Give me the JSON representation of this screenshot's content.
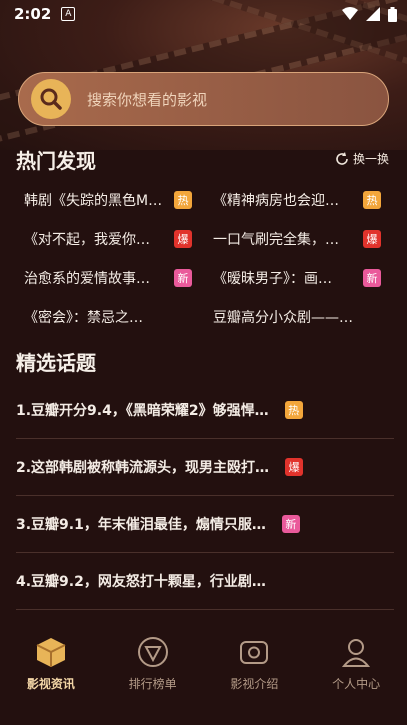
{
  "status_bar": {
    "time": "2:02",
    "notif_icon": "A"
  },
  "search": {
    "placeholder": "搜索你想看的影视"
  },
  "hot": {
    "title": "热门发现",
    "refresh_label": "换一换",
    "items": [
      {
        "text": "韩剧《失踪的黑色M…",
        "badge": "热",
        "badge_type": "hot"
      },
      {
        "text": "《精神病房也会迎…",
        "badge": "热",
        "badge_type": "hot"
      },
      {
        "text": "《对不起，我爱你…",
        "badge": "爆",
        "badge_type": "bao"
      },
      {
        "text": "一口气刷完全集，…",
        "badge": "爆",
        "badge_type": "bao"
      },
      {
        "text": "治愈系的爱情故事…",
        "badge": "新",
        "badge_type": "new"
      },
      {
        "text": "《暧昧男子》：画…",
        "badge": "新",
        "badge_type": "new"
      },
      {
        "text": "《密会》：禁忌之…",
        "badge": "",
        "badge_type": ""
      },
      {
        "text": "豆瓣高分小众剧——…",
        "badge": "",
        "badge_type": ""
      }
    ]
  },
  "topics": {
    "title": "精选话题",
    "items": [
      {
        "text": "1.豆瓣开分9.4，《黑暗荣耀2》够强悍…",
        "badge": "热",
        "badge_type": "hot"
      },
      {
        "text": "2.这部韩剧被称韩流源头，现男主殴打…",
        "badge": "爆",
        "badge_type": "bao"
      },
      {
        "text": "3.豆瓣9.1，年末催泪最佳，煽情只服…",
        "badge": "新",
        "badge_type": "new"
      },
      {
        "text": "4.豆瓣9.2，网友怒打十颗星，行业剧…",
        "badge": "",
        "badge_type": ""
      }
    ]
  },
  "tabbar": {
    "tabs": [
      {
        "label": "影视资讯",
        "icon": "box-icon",
        "active": true
      },
      {
        "label": "排行榜单",
        "icon": "ranking-icon",
        "active": false
      },
      {
        "label": "影视介绍",
        "icon": "camera-icon",
        "active": false
      },
      {
        "label": "个人中心",
        "icon": "person-icon",
        "active": false
      }
    ]
  },
  "colors": {
    "background": "#23100f",
    "search_icon": "#e8b458",
    "hot": "#f3a63b",
    "bao": "#e1332c",
    "new": "#ea5a9b",
    "active_tab": "#f2d5a6"
  }
}
